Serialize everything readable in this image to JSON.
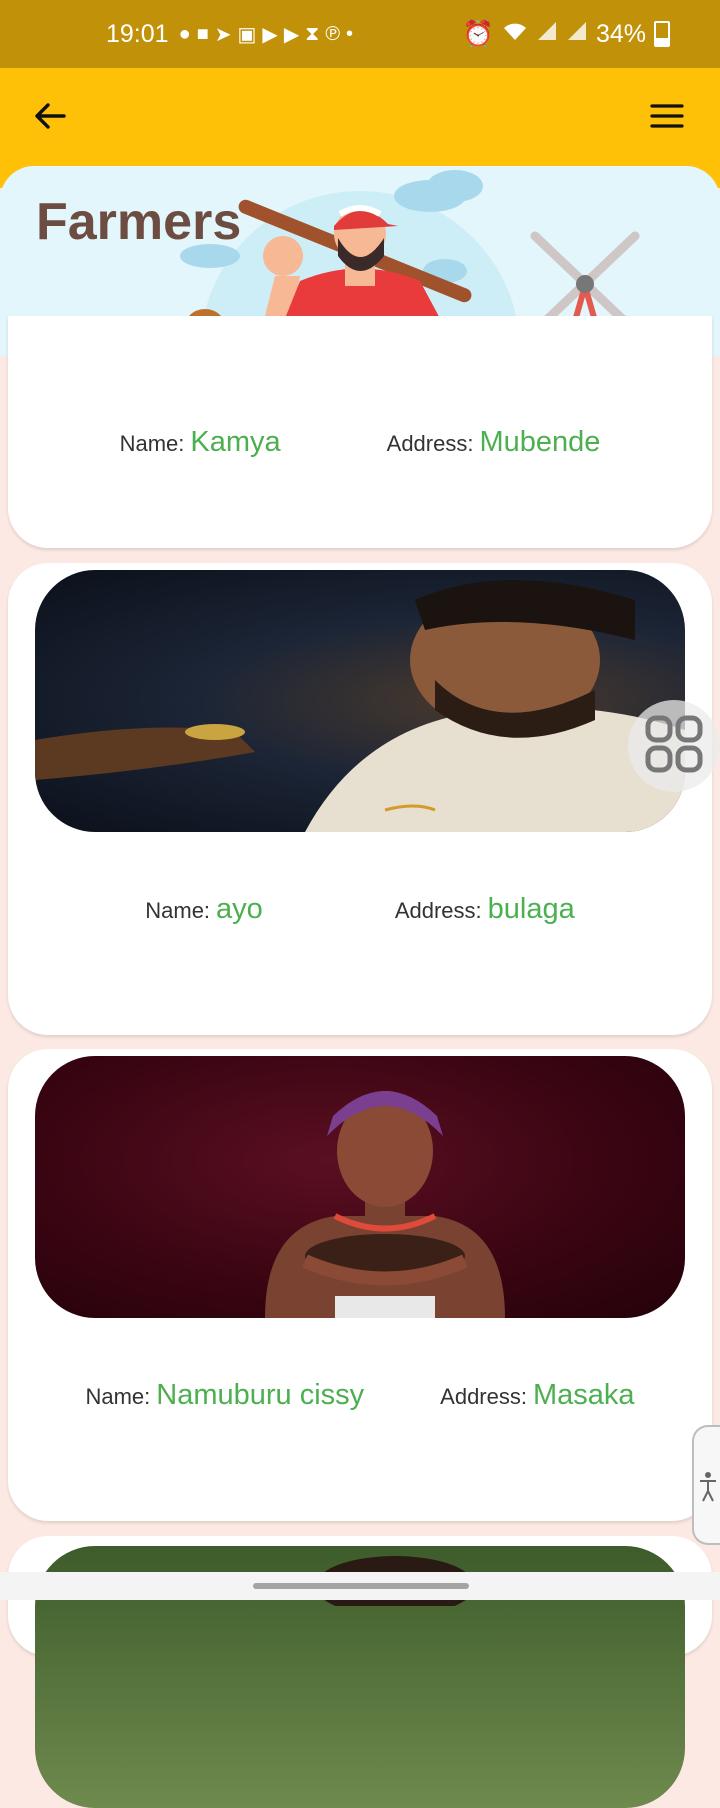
{
  "status_bar": {
    "time": "19:01",
    "battery_text": "34%",
    "notification_icons": [
      "whatsapp-icon",
      "message-icon",
      "telegram-icon",
      "viber-icon",
      "youtube-icon",
      "youtube-icon",
      "hourglass-icon",
      "pinterest-icon",
      "dot-icon"
    ]
  },
  "app_bar": {
    "back_icon": "arrow-left-icon",
    "menu_icon": "hamburger-menu-icon"
  },
  "banner": {
    "title": "Farmers"
  },
  "labels": {
    "name": "Name:",
    "address": "Address:"
  },
  "farmers": [
    {
      "name": "Kamya",
      "address": "Mubende"
    },
    {
      "name": "ayo",
      "address": "bulaga"
    },
    {
      "name": "Namuburu cissy",
      "address": "Masaka"
    }
  ],
  "colors": {
    "status_bar": "#c19209",
    "app_bar": "#ffc107",
    "title": "#6d4c41",
    "value_text": "#4caf50",
    "background": "#fde9e3"
  }
}
